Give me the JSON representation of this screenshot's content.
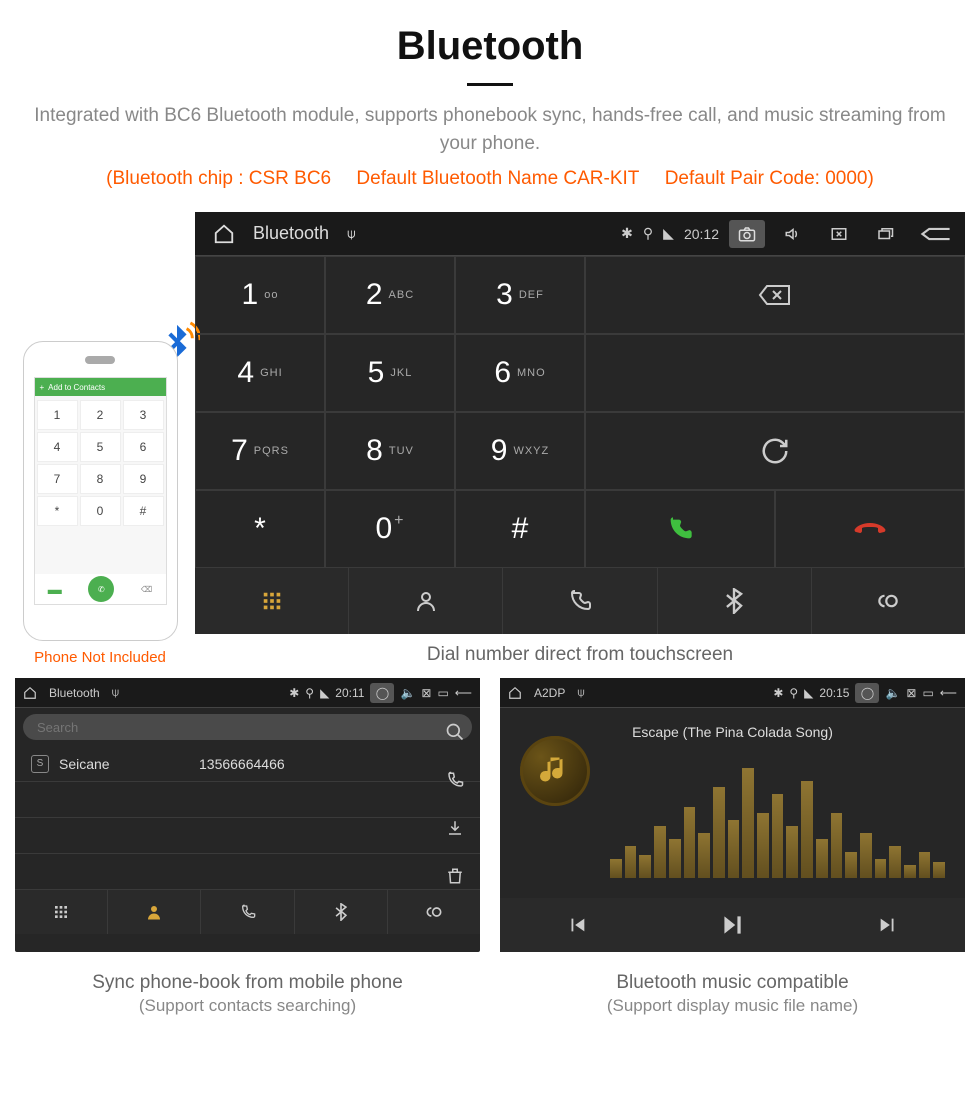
{
  "title": "Bluetooth",
  "desc": "Integrated with BC6 Bluetooth module, supports phonebook sync, hands-free call, and music streaming from your phone.",
  "specs": {
    "chip": "(Bluetooth chip : CSR BC6",
    "name": "Default Bluetooth Name CAR-KIT",
    "pair": "Default Pair Code: 0000)"
  },
  "phone": {
    "add_contacts": "Add to Contacts",
    "note": "Phone Not Included",
    "keys": [
      "1",
      "2",
      "3",
      "4",
      "5",
      "6",
      "7",
      "8",
      "9",
      "*",
      "0",
      "#"
    ]
  },
  "dialer": {
    "status": {
      "title": "Bluetooth",
      "time": "20:12"
    },
    "keys": [
      {
        "num": "1",
        "sub": "ᴏᴏ"
      },
      {
        "num": "2",
        "sub": "ABC"
      },
      {
        "num": "3",
        "sub": "DEF"
      },
      {
        "num": "4",
        "sub": "GHI"
      },
      {
        "num": "5",
        "sub": "JKL"
      },
      {
        "num": "6",
        "sub": "MNO"
      },
      {
        "num": "7",
        "sub": "PQRS"
      },
      {
        "num": "8",
        "sub": "TUV"
      },
      {
        "num": "9",
        "sub": "WXYZ"
      },
      {
        "num": "*",
        "sub": ""
      },
      {
        "num": "0",
        "sub": "+",
        "sup": true
      },
      {
        "num": "#",
        "sub": ""
      }
    ],
    "caption": "Dial number direct from touchscreen"
  },
  "contacts": {
    "status_title": "Bluetooth",
    "status_time": "20:11",
    "search_placeholder": "Search",
    "row_badge": "S",
    "row_name": "Seicane",
    "row_number": "13566664466",
    "caption": "Sync phone-book from mobile phone",
    "caption_sub": "(Support contacts searching)"
  },
  "music": {
    "status_title": "A2DP",
    "status_time": "20:15",
    "song": "Escape (The Pina Colada Song)",
    "caption": "Bluetooth music compatible",
    "caption_sub": "(Support display music file name)"
  }
}
